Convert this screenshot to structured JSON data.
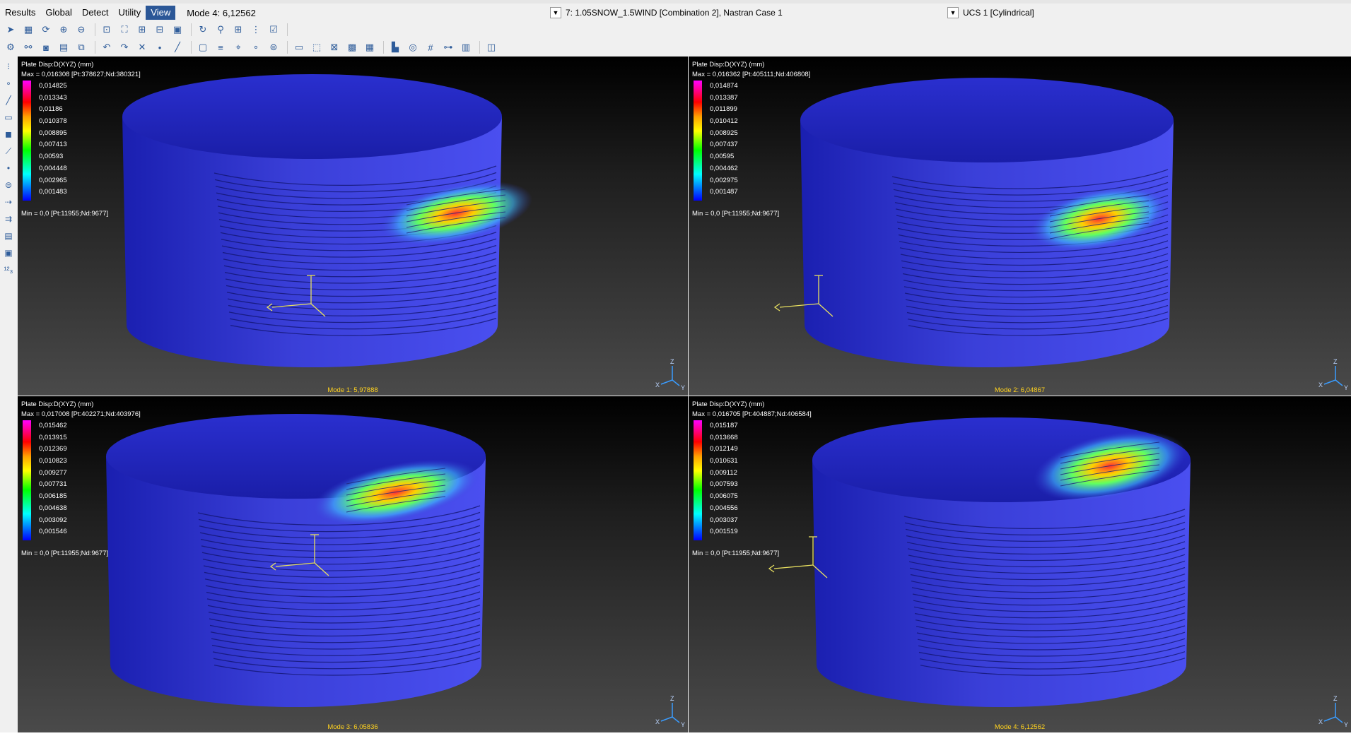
{
  "menubar": {
    "items": [
      "Results",
      "Global",
      "Detect",
      "Utility",
      "View"
    ],
    "active": "View",
    "mode_field": "Mode 4: 6,12562"
  },
  "combos": {
    "load_case": "7: 1.05SNOW_1.5WIND [Combination 2], Nastran Case 1",
    "ucs": "UCS 1 [Cylindrical]"
  },
  "toolbar_icons": {
    "row1": [
      "pick-icon",
      "model-icon",
      "refresh-icon",
      "zoom-in-icon",
      "zoom-out-icon",
      "zoom-box-icon",
      "zoom-fit-icon",
      "add-icon",
      "remove-icon",
      "view-icon",
      "rotate-icon",
      "magnify-icon",
      "layout-4-icon",
      "grid-icon",
      "check-icon"
    ],
    "row2": [
      "settings-icon",
      "binoculars-icon",
      "camera-icon",
      "layer-icon",
      "copy-icon",
      "undo-icon",
      "redo-icon",
      "delete-icon",
      "node-icon",
      "line-icon",
      "shell-icon",
      "stack-icon",
      "probe-icon",
      "point-icon",
      "cylinder-icon",
      "ruler-icon",
      "select-icon",
      "mesh-icon",
      "grid2-icon",
      "table-icon",
      "chart-icon",
      "plane-icon",
      "hash-icon",
      "tree-icon",
      "render-icon",
      "section-icon"
    ]
  },
  "left_tools": [
    "dots-icon",
    "point-icon",
    "line-icon",
    "rect-icon",
    "solid-icon",
    "beam-icon",
    "node-icon",
    "cylinder-icon",
    "link-icon",
    "flow-icon",
    "panel-icon",
    "screen-icon",
    "numbering-icon"
  ],
  "viewports": [
    {
      "title": "Plate Disp:D(XYZ)  (mm)",
      "max": "Max = 0,016308 [Pt:378627;Nd:380321]",
      "min": "Min = 0,0 [Pt:11955;Nd:9677]",
      "legend": [
        "0,014825",
        "0,013343",
        "0,01186",
        "0,010378",
        "0,008895",
        "0,007413",
        "0,00593",
        "0,004448",
        "0,002965",
        "0,001483"
      ],
      "caption": "Mode 1: 5,97888"
    },
    {
      "title": "Plate Disp:D(XYZ)  (mm)",
      "max": "Max = 0,016362 [Pt:405111;Nd:406808]",
      "min": "Min = 0,0 [Pt:11955;Nd:9677]",
      "legend": [
        "0,014874",
        "0,013387",
        "0,011899",
        "0,010412",
        "0,008925",
        "0,007437",
        "0,00595",
        "0,004462",
        "0,002975",
        "0,001487"
      ],
      "caption": "Mode 2: 6,04867"
    },
    {
      "title": "Plate Disp:D(XYZ)  (mm)",
      "max": "Max = 0,017008 [Pt:402271;Nd:403976]",
      "min": "Min = 0,0 [Pt:11955;Nd:9677]",
      "legend": [
        "0,015462",
        "0,013915",
        "0,012369",
        "0,010823",
        "0,009277",
        "0,007731",
        "0,006185",
        "0,004638",
        "0,003092",
        "0,001546"
      ],
      "caption": "Mode 3: 6,05836"
    },
    {
      "title": "Plate Disp:D(XYZ)  (mm)",
      "max": "Max = 0,016705 [Pt:404887;Nd:406584]",
      "min": "Min = 0,0 [Pt:11955;Nd:9677]",
      "legend": [
        "0,015187",
        "0,013668",
        "0,012149",
        "0,010631",
        "0,009112",
        "0,007593",
        "0,006075",
        "0,004556",
        "0,003037",
        "0,001519"
      ],
      "caption": "Mode 4: 6,12562"
    }
  ],
  "axis_labels": {
    "x": "X",
    "y": "Y",
    "z": "Z"
  },
  "colors": {
    "caption": "#ffd21f",
    "model_blue": "#3a3fd8",
    "active_menu": "#2b5797"
  }
}
